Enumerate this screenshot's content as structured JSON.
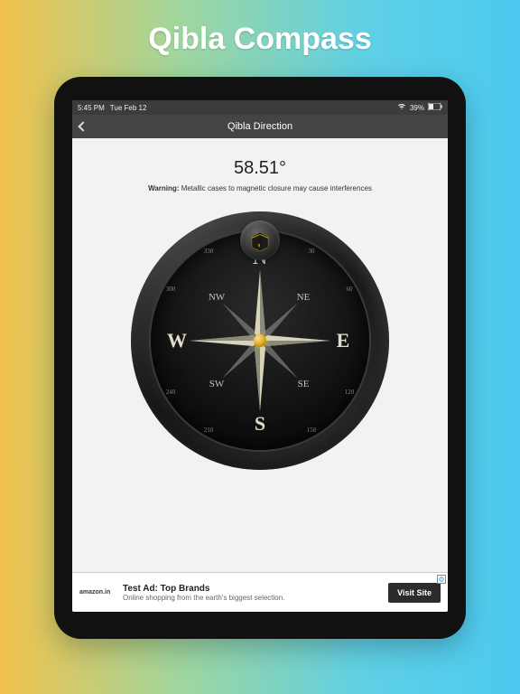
{
  "promo_title": "Qibla Compass",
  "status": {
    "time": "5:45 PM",
    "date": "Tue Feb 12",
    "battery": "39%"
  },
  "nav": {
    "title": "Qibla Direction"
  },
  "reading": {
    "degree": "58.51°",
    "warning_label": "Warning:",
    "warning_text": " Metallic cases to magnetic closure may cause interferences"
  },
  "compass": {
    "cardinals": {
      "n": "N",
      "e": "E",
      "s": "S",
      "w": "W"
    },
    "intercards": {
      "ne": "NE",
      "se": "SE",
      "sw": "SW",
      "nw": "NW"
    },
    "degree_labels": [
      "30",
      "60",
      "120",
      "150",
      "210",
      "240",
      "300",
      "330"
    ]
  },
  "ad": {
    "brand": "amazon.in",
    "title": "Test Ad: Top Brands",
    "subtitle": "Online shopping from the earth's biggest selection.",
    "cta": "Visit Site"
  }
}
